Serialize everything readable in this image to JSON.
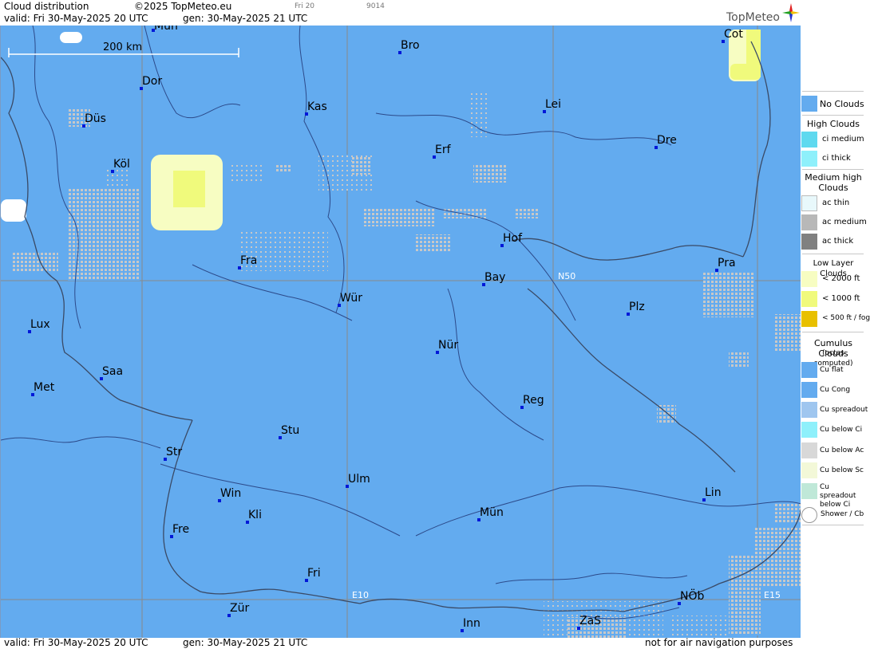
{
  "header": {
    "title": "Cloud distribution",
    "copyright": "©2025 TopMeteo.eu",
    "small_day": "Fri 20",
    "small_code": "9014",
    "valid": "valid:  Fri  30-May-2025  20 UTC",
    "gen": "gen: 30-May-2025 21 UTC",
    "logo": "TopMeteo"
  },
  "footer": {
    "valid": "valid:  Fri  30-May-2025  20 UTC",
    "gen": "gen: 30-May-2025 21 UTC",
    "note": "not for air navigation purposes"
  },
  "map": {
    "scale_label": "200 km",
    "grid_labels": {
      "n50": "N50",
      "e10": "E10",
      "e15": "E15"
    },
    "colors": {
      "no_clouds": "#63abef",
      "grid": "#8a8a8a",
      "border": "#3a4a66",
      "city_dot": "#0018d8",
      "cloud_grey": "#c8c8c8",
      "low_cloud_pale": "#f7fdc2",
      "low_cloud_bright": "#f0fa7c"
    },
    "cities": [
      {
        "name": "Mün",
        "id": "mun-top"
      },
      {
        "name": "Bro",
        "id": "bro"
      },
      {
        "name": "Cot",
        "id": "cot"
      },
      {
        "name": "Dor",
        "id": "dor"
      },
      {
        "name": "Kas",
        "id": "kas"
      },
      {
        "name": "Lei",
        "id": "lei"
      },
      {
        "name": "Düs",
        "id": "dus"
      },
      {
        "name": "Dre",
        "id": "dre"
      },
      {
        "name": "Erf",
        "id": "erf"
      },
      {
        "name": "Köl",
        "id": "kol"
      },
      {
        "name": "Hof",
        "id": "hof"
      },
      {
        "name": "Fra",
        "id": "fra"
      },
      {
        "name": "Pra",
        "id": "pra"
      },
      {
        "name": "Bay",
        "id": "bay"
      },
      {
        "name": "Wür",
        "id": "wur"
      },
      {
        "name": "Plz",
        "id": "plz"
      },
      {
        "name": "Lux",
        "id": "lux"
      },
      {
        "name": "Nür",
        "id": "nur"
      },
      {
        "name": "Saa",
        "id": "saa"
      },
      {
        "name": "Met",
        "id": "met"
      },
      {
        "name": "Reg",
        "id": "reg"
      },
      {
        "name": "Stu",
        "id": "stu"
      },
      {
        "name": "Str",
        "id": "str"
      },
      {
        "name": "Ulm",
        "id": "ulm"
      },
      {
        "name": "Win",
        "id": "win"
      },
      {
        "name": "Lin",
        "id": "lin"
      },
      {
        "name": "Kli",
        "id": "kli"
      },
      {
        "name": "Mün",
        "id": "mun"
      },
      {
        "name": "Fre",
        "id": "fre"
      },
      {
        "name": "Fri",
        "id": "fri"
      },
      {
        "name": "NÖb",
        "id": "nob"
      },
      {
        "name": "Zür",
        "id": "zur"
      },
      {
        "name": "ZaS",
        "id": "zas"
      },
      {
        "name": "Inn",
        "id": "inn"
      }
    ]
  },
  "legend": {
    "no_clouds": "No Clouds",
    "high_clouds": "High Clouds",
    "ci_medium": "ci medium",
    "ci_thick": "ci thick",
    "medium_high": "Medium high Clouds",
    "ac_thin": "ac thin",
    "ac_medium": "ac medium",
    "ac_thick": "ac thick",
    "low_layer": "Low Layer Clouds",
    "lt2000": "< 2000 ft",
    "lt1000": "< 1000 ft",
    "lt500": "< 500 ft / fog",
    "cumulus": "Cumulus Clouds",
    "octas": "(octas computed)",
    "cu_flat": "Cu flat",
    "cu_cong": "Cu Cong",
    "cu_spread": "Cu spreadout",
    "cu_below_ci": "Cu below Ci",
    "cu_below_ac": "Cu below Ac",
    "cu_below_sc": "Cu below Sc",
    "cu_spread_ci": "Cu spreadout below Ci",
    "shower": "Shower / Cb"
  }
}
